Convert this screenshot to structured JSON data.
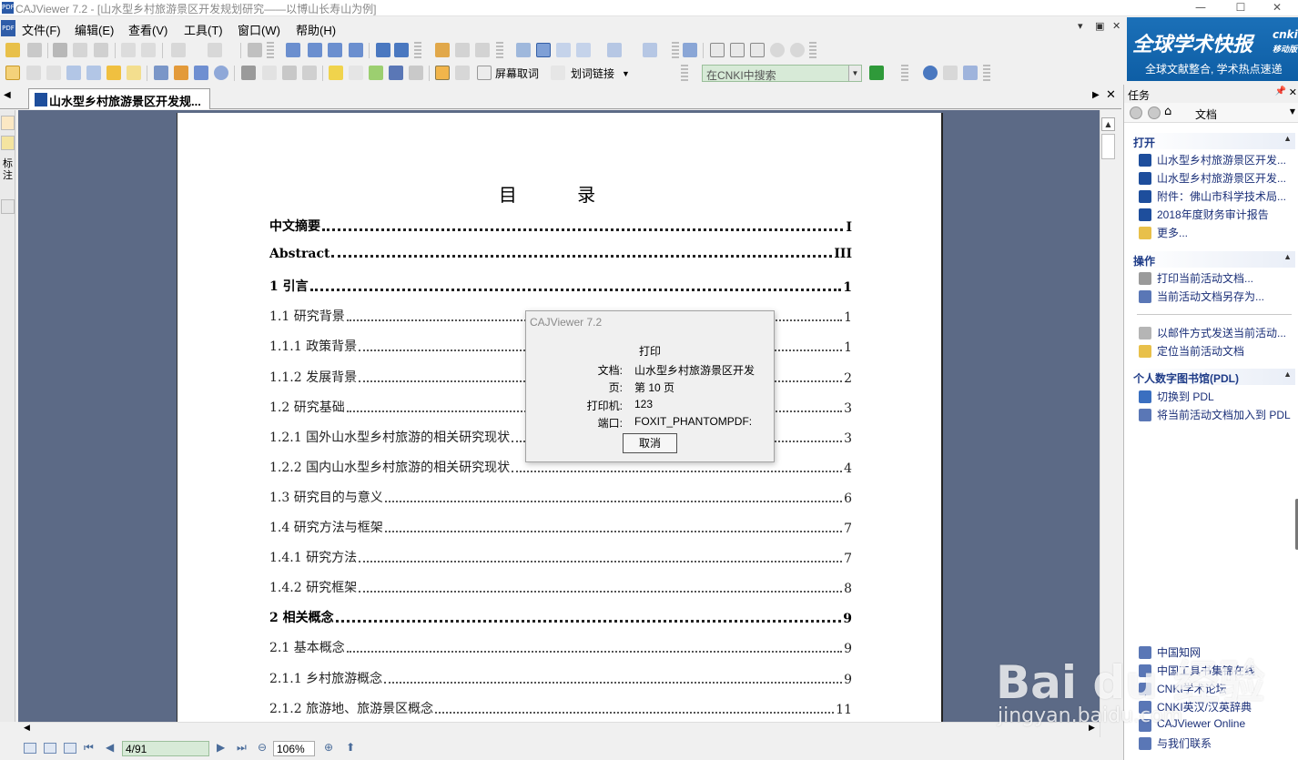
{
  "window": {
    "title": "CAJViewer 7.2 - [山水型乡村旅游景区开发规划研究——以博山长寿山为例]",
    "controls": {
      "minimize": "—",
      "maximize": "☐",
      "close": "✕"
    }
  },
  "menu": {
    "items": [
      "文件(F)",
      "编辑(E)",
      "查看(V)",
      "工具(T)",
      "窗口(W)",
      "帮助(H)"
    ],
    "mdi": {
      "minimize": "▾",
      "restore": "▣",
      "close": "✕"
    }
  },
  "toolbar": {
    "screen_word": "屏幕取词",
    "word_link": "划词链接",
    "search_placeholder": "在CNKI中搜索"
  },
  "banner": {
    "title": "全球学术快报",
    "badge": "cnki",
    "badge_sub": "移动版",
    "subtitle": "全球文献整合, 学术热点速递"
  },
  "tab": {
    "label": "山水型乡村旅游景区开发规..."
  },
  "left_strip": {
    "annot_label": "标注"
  },
  "document": {
    "title": "目 录",
    "toc": [
      {
        "text": "中文摘要",
        "page": "I",
        "bold": true
      },
      {
        "text": "Abstract",
        "page": "III",
        "bold": true
      },
      {
        "text": "1 引言",
        "page": "1",
        "bold": true
      },
      {
        "text": "1.1 研究背景",
        "page": "1",
        "bold": false
      },
      {
        "text": "1.1.1 政策背景",
        "page": "1",
        "bold": false
      },
      {
        "text": "1.1.2 发展背景",
        "page": "2",
        "bold": false
      },
      {
        "text": "1.2 研究基础",
        "page": "3",
        "bold": false
      },
      {
        "text": "1.2.1 国外山水型乡村旅游的相关研究现状",
        "page": "3",
        "bold": false
      },
      {
        "text": "1.2.2 国内山水型乡村旅游的相关研究现状",
        "page": "4",
        "bold": false
      },
      {
        "text": "1.3 研究目的与意义",
        "page": "6",
        "bold": false
      },
      {
        "text": "1.4 研究方法与框架",
        "page": "7",
        "bold": false
      },
      {
        "text": "1.4.1 研究方法",
        "page": "7",
        "bold": false
      },
      {
        "text": "1.4.2 研究框架",
        "page": "8",
        "bold": false
      },
      {
        "text": "2  相关概念",
        "page": "9",
        "bold": true
      },
      {
        "text": "2.1 基本概念",
        "page": "9",
        "bold": false
      },
      {
        "text": "2.1.1 乡村旅游概念",
        "page": "9",
        "bold": false
      },
      {
        "text": "2.1.2 旅游地、旅游景区概念",
        "page": "11",
        "bold": false
      }
    ]
  },
  "statusbar": {
    "page": "4/91",
    "zoom": "106%"
  },
  "taskpane": {
    "title": "任务",
    "nav_label": "文档",
    "open_section": "打开",
    "open_items": [
      "山水型乡村旅游景区开发...",
      "山水型乡村旅游景区开发...",
      "附件：佛山市科学技术局...",
      "2018年度财务审计报告",
      "更多..."
    ],
    "ops_section": "操作",
    "ops_items": [
      "打印当前活动文档...",
      "当前活动文档另存为..."
    ],
    "ops_items2": [
      "以邮件方式发送当前活动...",
      "定位当前活动文档"
    ],
    "pdl_section": "个人数字图书馆(PDL)",
    "pdl_items": [
      "切换到 PDL",
      "将当前活动文档加入到 PDL"
    ],
    "links": [
      "中国知网",
      "中国工具书集锦在线",
      "CNKI学术论坛",
      "CNKI英汉/汉英辞典",
      "CAJViewer Online",
      "与我们联系"
    ]
  },
  "dialog": {
    "title": "CAJViewer 7.2",
    "heading": "打印",
    "rows": [
      {
        "key": "文档:",
        "value": "山水型乡村旅游景区开发"
      },
      {
        "key": "页:",
        "value": "第 10 页"
      },
      {
        "key": "打印机:",
        "value": "123"
      },
      {
        "key": "端口:",
        "value": "FOXIT_PHANTOMPDF:"
      }
    ],
    "cancel": "取消"
  },
  "watermark": {
    "logo": "Bai du 经验",
    "url": "jingyan.baidu.com"
  },
  "colors": {
    "doc_bg": "#5c6a86",
    "banner": "#1b70b8",
    "link": "#1a2f78",
    "field_green": "#d7ead7"
  }
}
